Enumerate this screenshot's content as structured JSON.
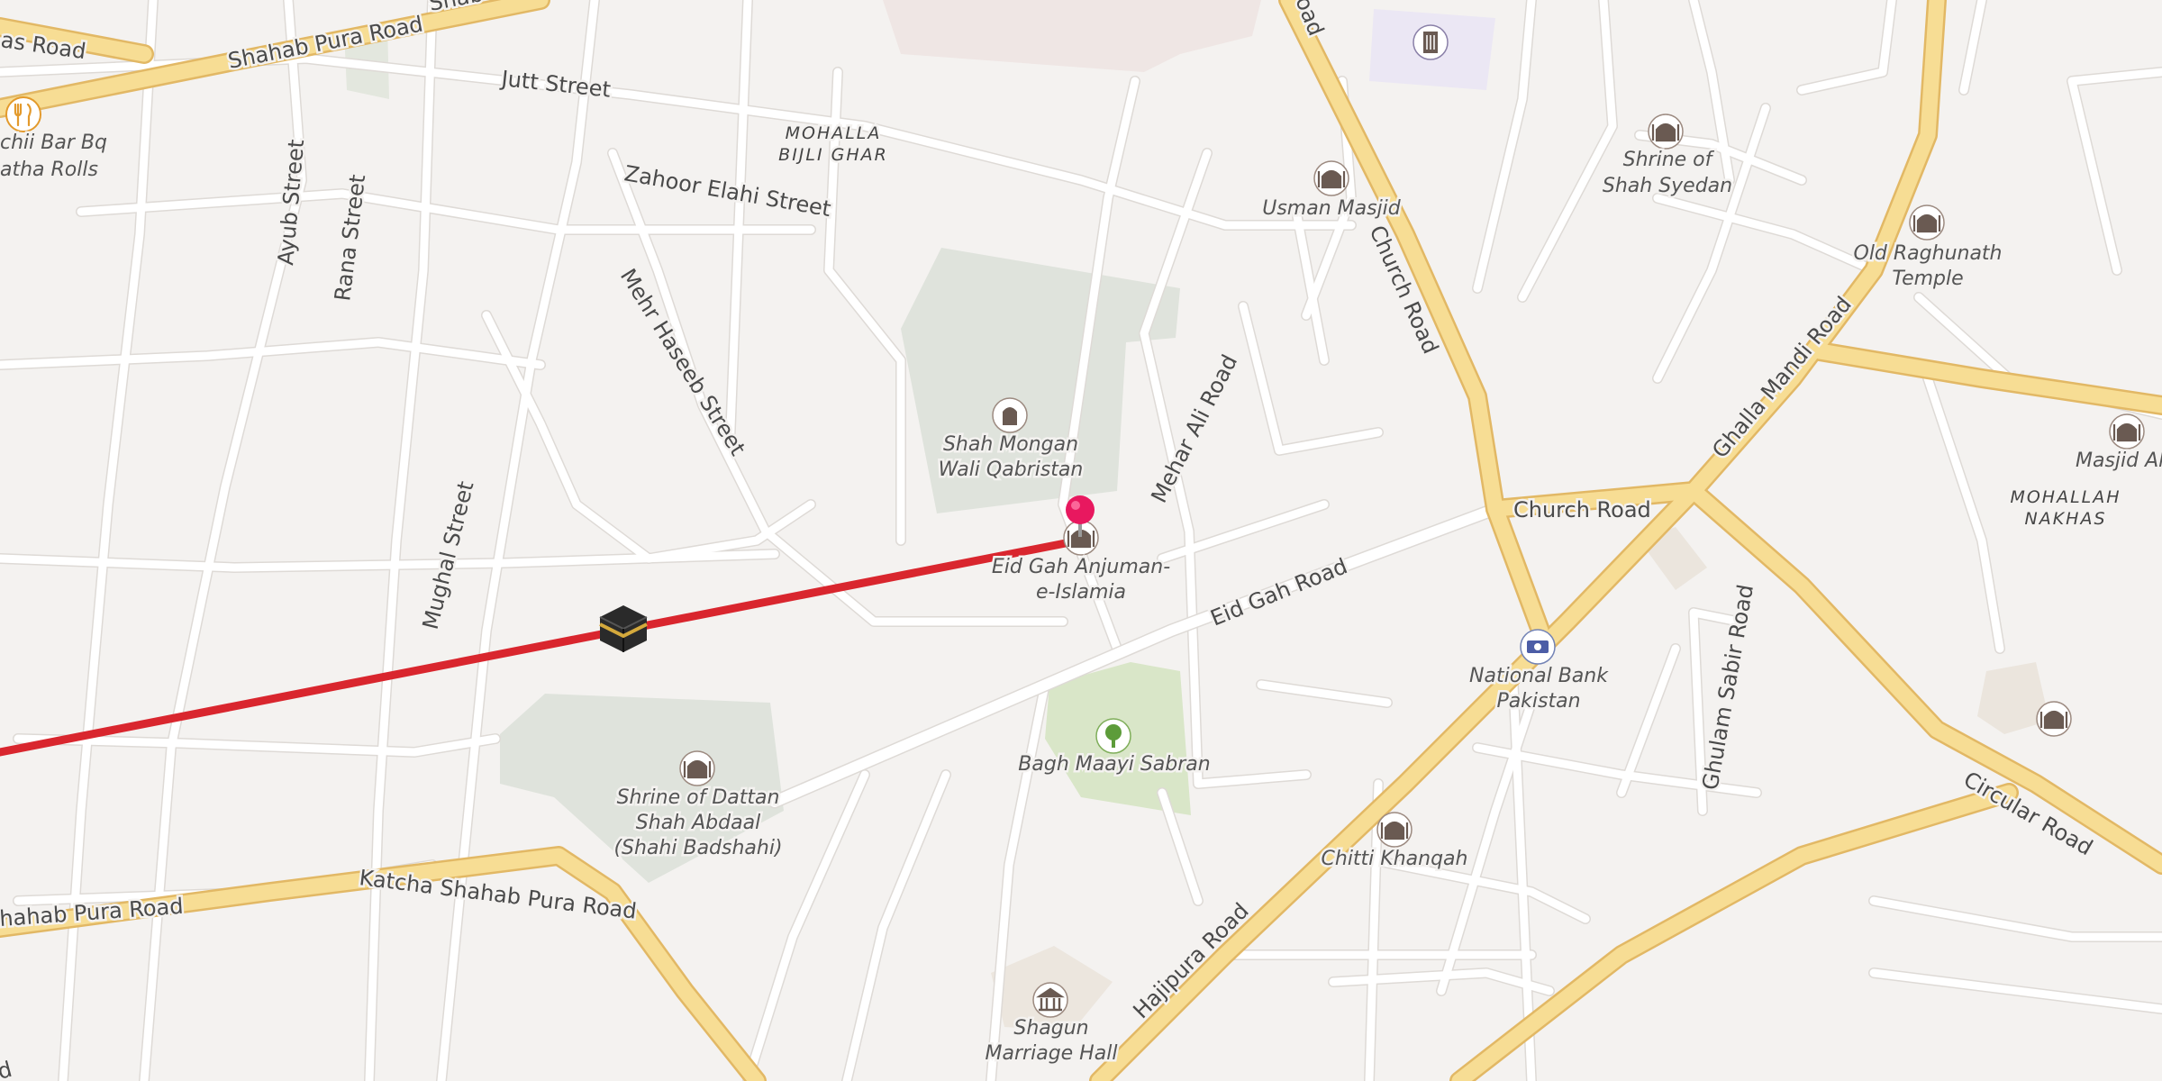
{
  "map": {
    "roads": {
      "shahab_pura_road": "Shahab Pura Road",
      "shahab_pura_road_cut": "Shab",
      "das_road_fragment": "as Road",
      "jutt_street": "Jutt Street",
      "zahoor_elahi_street": "Zahoor Elahi Street",
      "ayub_street": "Ayub Street",
      "rana_street": "Rana Street",
      "mehr_haseeb_street": "Mehr Haseeb Street",
      "mughal_street": "Mughal Street",
      "mehar_ali_road": "Mehar Ali Road",
      "eid_gah_road": "Eid Gah Road",
      "church_road_vertical": "Church Road",
      "church_road_horizontal": "Church Road",
      "road_top_fragment": "oad",
      "ghalla_mandi_road": "Ghalla Mandi Road",
      "ghulam_sabir_road": "Ghulam Sabir Road",
      "circular_road": "Circular Road",
      "hajipura_road": "Hajipura Road",
      "katcha_shahab_pura_road": "Katcha Shahab Pura Road",
      "shahab_pura_road_bottom": "hahab Pura Road",
      "bottom_left_fragment": "d"
    },
    "areas": {
      "mohalla_bijli_ghar_line1": "MOHALLA",
      "mohalla_bijli_ghar_line2": "BIJLI GHAR",
      "mohallah_nakhas_line1": "MOHALLAH",
      "mohallah_nakhas_line2": "NAKHAS"
    },
    "pois": {
      "bbq_line1": "chii Bar Bq",
      "bbq_line2": "atha Rolls",
      "usman_masjid": "Usman Masjid",
      "shrine_syedan_line1": "Shrine of",
      "shrine_syedan_line2": "Shah Syedan",
      "old_raghunath_line1": "Old Raghunath",
      "old_raghunath_line2": "Temple",
      "masjid_ahle": "Masjid AhleH",
      "shah_mongan_line1": "Shah Mongan",
      "shah_mongan_line2": "Wali Qabristan",
      "eid_gah_line1": "Eid Gah Anjuman-",
      "eid_gah_line2": "e-Islamia",
      "national_bank_line1": "National Bank",
      "national_bank_line2": "Pakistan",
      "bagh_maayi_sabran": "Bagh Maayi Sabran",
      "dattan_shah_line1": "Shrine of Dattan",
      "dattan_shah_line2": "Shah Abdaal",
      "dattan_shah_line3": "(Shahi Badshahi)",
      "chitti_khanqah": "Chitti Khanqah",
      "shagun_line1": "Shagun",
      "shagun_line2": "Marriage Hall"
    },
    "icons": {
      "restaurant": "fork-knife-icon",
      "mosque": "mosque-icon",
      "shrine": "shrine-icon",
      "temple": "temple-icon",
      "cemetery": "tombstone-icon",
      "bank": "banknote-icon",
      "park": "tree-icon",
      "hall": "hall-icon",
      "kaaba": "kaaba-icon",
      "pin": "location-pin-icon",
      "building": "building-icon"
    },
    "colors": {
      "background": "#f4f2f0",
      "major_road": "#f7dd94",
      "minor_road": "#ffffff",
      "park": "#d9e6c8",
      "cemetery": "#dfe3dc",
      "qibla_line": "#d9262e",
      "pin": "#e8185f"
    }
  }
}
